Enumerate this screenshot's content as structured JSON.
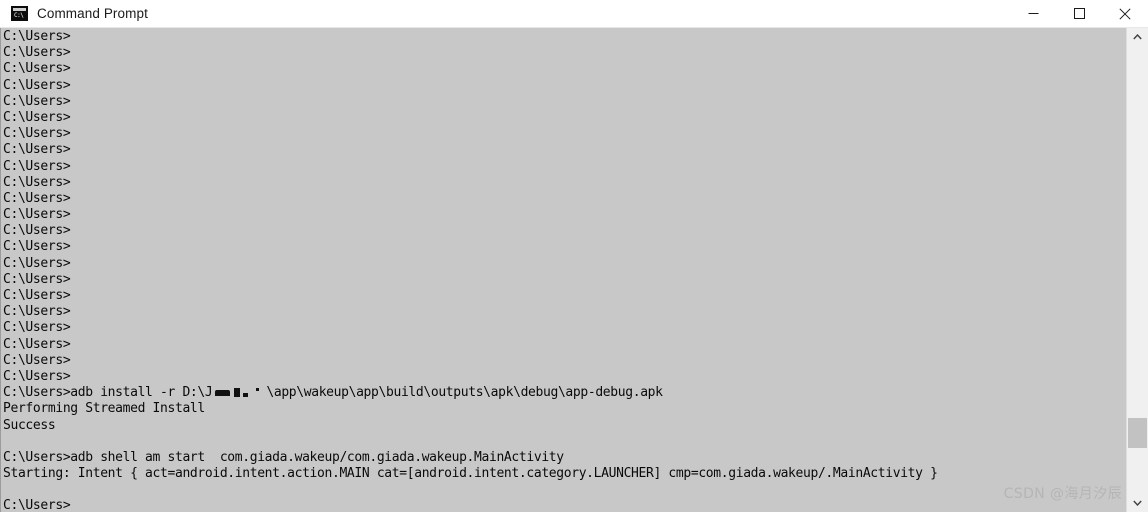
{
  "window": {
    "title": "Command Prompt",
    "icon_name": "console-icon",
    "icon_glyph": "C:\\",
    "controls": {
      "minimize": "–",
      "maximize": "□",
      "close": "✕"
    }
  },
  "colors": {
    "titlebar_bg": "#ffffff",
    "console_bg": "#c8c8c8",
    "console_fg": "#0a0a0a",
    "scrollbar_bg": "#f0f0f0",
    "scrollbar_thumb": "#c2c2c2",
    "watermark_fg": "#b5b5b5"
  },
  "console": {
    "prompt": "C:\\Users>",
    "blank_prompt_count": 22,
    "lines": [
      {
        "type": "prompt",
        "text": "C:\\Users>"
      },
      {
        "type": "prompt",
        "text": "C:\\Users>"
      },
      {
        "type": "prompt",
        "text": "C:\\Users>"
      },
      {
        "type": "prompt",
        "text": "C:\\Users>"
      },
      {
        "type": "prompt",
        "text": "C:\\Users>"
      },
      {
        "type": "prompt",
        "text": "C:\\Users>"
      },
      {
        "type": "prompt",
        "text": "C:\\Users>"
      },
      {
        "type": "prompt",
        "text": "C:\\Users>"
      },
      {
        "type": "prompt",
        "text": "C:\\Users>"
      },
      {
        "type": "prompt",
        "text": "C:\\Users>"
      },
      {
        "type": "prompt",
        "text": "C:\\Users>"
      },
      {
        "type": "prompt",
        "text": "C:\\Users>"
      },
      {
        "type": "prompt",
        "text": "C:\\Users>"
      },
      {
        "type": "prompt",
        "text": "C:\\Users>"
      },
      {
        "type": "prompt",
        "text": "C:\\Users>"
      },
      {
        "type": "prompt",
        "text": "C:\\Users>"
      },
      {
        "type": "prompt",
        "text": "C:\\Users>"
      },
      {
        "type": "prompt",
        "text": "C:\\Users>"
      },
      {
        "type": "prompt",
        "text": "C:\\Users>"
      },
      {
        "type": "prompt",
        "text": "C:\\Users>"
      },
      {
        "type": "prompt",
        "text": "C:\\Users>"
      },
      {
        "type": "prompt",
        "text": "C:\\Users>"
      }
    ],
    "install_command": {
      "prefix": "C:\\Users>adb install -r D:\\J",
      "redacted": true,
      "suffix": "\\app\\wakeup\\app\\build\\outputs\\apk\\debug\\app-debug.apk"
    },
    "install_output_1": "Performing Streamed Install",
    "install_output_2": "Success",
    "blank_1": "",
    "start_command": "C:\\Users>adb shell am start  com.giada.wakeup/com.giada.wakeup.MainActivity",
    "start_output": "Starting: Intent { act=android.intent.action.MAIN cat=[android.intent.category.LAUNCHER] cmp=com.giada.wakeup/.MainActivity }",
    "blank_2": "",
    "final_prompt": "C:\\Users>"
  },
  "scrollbar": {
    "up_arrow": "⌃",
    "down_arrow": "⌄"
  },
  "watermark": {
    "text": "CSDN @海月汐辰"
  }
}
